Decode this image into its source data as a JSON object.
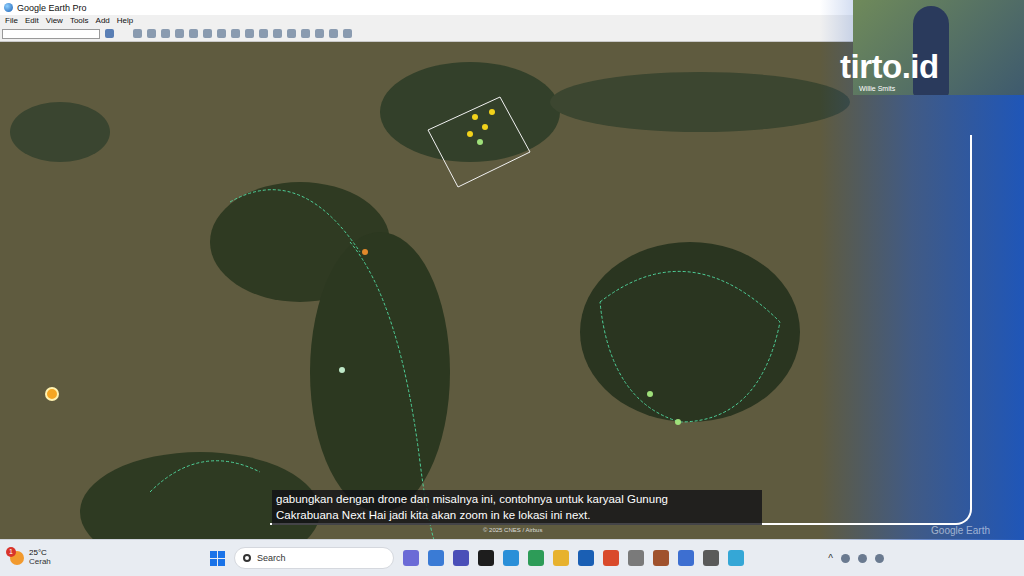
{
  "window": {
    "title": "Google Earth Pro"
  },
  "menu": [
    "File",
    "Edit",
    "View",
    "Tools",
    "Add",
    "Help"
  ],
  "toolbar": {
    "search_value": "",
    "icon_count": 16
  },
  "map": {
    "attribution": "© 2025 CNES / Airbus",
    "watermark": "Google Earth"
  },
  "caption": {
    "lines": [
      "gabungkan dengan drone dan misalnya ini, contohnya untuk karyaal Gunung",
      "Cakrabuana Next Hai jadi kita akan zoom in ke lokasi ini next."
    ]
  },
  "overlay": {
    "brand": "tirto.id",
    "speaker": "Willie Smits"
  },
  "taskbar": {
    "weather": {
      "temp": "25°C",
      "condition": "Cerah",
      "badge": "1"
    },
    "search": {
      "placeholder": "Search"
    },
    "apps": [
      {
        "color": "#6b6bd6"
      },
      {
        "color": "#3a7bd5"
      },
      {
        "color": "#4a4fb8"
      },
      {
        "color": "#1d1d1d"
      },
      {
        "color": "#2a8fd8"
      },
      {
        "color": "#2d9c58"
      },
      {
        "color": "#e7b22e"
      },
      {
        "color": "#1a5fb4"
      },
      {
        "color": "#d94a2b"
      },
      {
        "color": "#7a7a7a"
      },
      {
        "color": "#a0522d"
      },
      {
        "color": "#3d6fd1"
      },
      {
        "color": "#5a5a5a"
      },
      {
        "color": "#35a7d6"
      }
    ],
    "tray": {
      "chevron": "^"
    }
  }
}
